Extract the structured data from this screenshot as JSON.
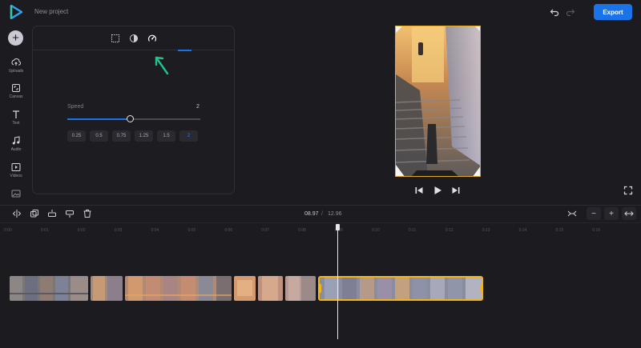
{
  "header": {
    "project_name": "New project",
    "export_label": "Export"
  },
  "sidebar": {
    "items": [
      {
        "label": "Uploads",
        "icon": "upload-icon"
      },
      {
        "label": "Canvas",
        "icon": "canvas-icon"
      },
      {
        "label": "Text",
        "icon": "text-icon"
      },
      {
        "label": "Audio",
        "icon": "audio-icon"
      },
      {
        "label": "Videos",
        "icon": "videos-icon"
      },
      {
        "label": "",
        "icon": "images-icon"
      }
    ]
  },
  "panel": {
    "tabs": [
      {
        "name": "crop",
        "icon": "crop-icon"
      },
      {
        "name": "filters",
        "icon": "contrast-icon"
      },
      {
        "name": "speed",
        "icon": "speedometer-icon",
        "active": true
      }
    ],
    "speed_label": "Speed",
    "speed_value": "2",
    "slider_fraction": 0.47,
    "presets": [
      "0.25",
      "0.5",
      "0.75",
      "1.25",
      "1.5",
      "2"
    ],
    "active_preset": "2"
  },
  "timeline": {
    "current_time": "08.97",
    "separator": "/",
    "total_time": "12.96",
    "ticks": [
      "0:00",
      "0:01",
      "0:02",
      "0:03",
      "0:04",
      "0:05",
      "0:06",
      "0:07",
      "0:08",
      "0:09",
      "0:10",
      "0:11",
      "0:12",
      "0:13",
      "0:14",
      "0:15",
      "0:16"
    ]
  },
  "colors": {
    "accent": "#1a73e8",
    "selection": "#f2b517",
    "annotation_arrow": "#21c28b",
    "background": "#1b1b20"
  }
}
